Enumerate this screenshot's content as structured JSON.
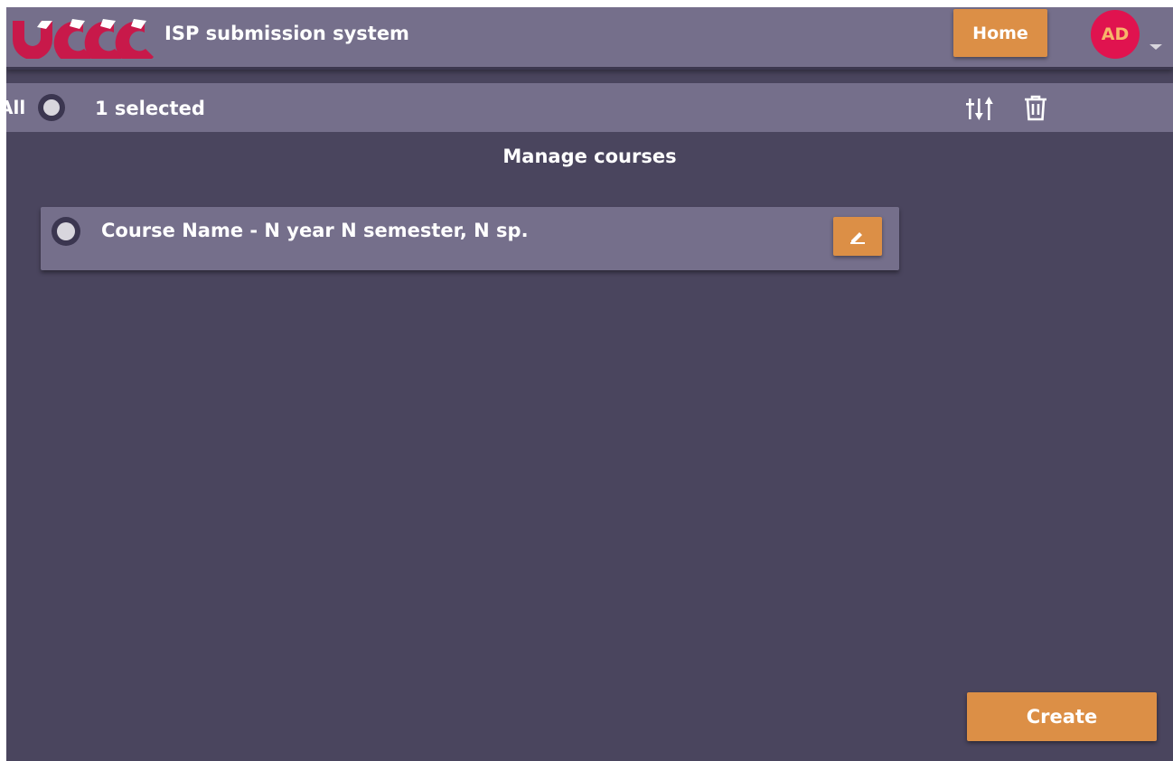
{
  "header": {
    "logo_icon": "ucu-logo-icon",
    "title": "ISP submission system",
    "home_label": "Home",
    "avatar_initials": "AD",
    "avatar_caret_icon": "caret-down-icon"
  },
  "toolbar": {
    "select_all_label": "All",
    "selected_count": "1 selected",
    "sort_icon": "sort-icon",
    "delete_icon": "trash-icon"
  },
  "main": {
    "page_title": "Manage courses",
    "courses": [
      {
        "name": "Course Name - N year N semester, N sp.",
        "edit_icon": "pencil-icon"
      }
    ],
    "create_label": "Create"
  },
  "colors": {
    "header_bg": "#756f8b",
    "page_bg": "#4a455e",
    "accent_orange": "#dc8f46",
    "avatar_red": "#e0134f",
    "logo_crimson": "#c8194a"
  }
}
